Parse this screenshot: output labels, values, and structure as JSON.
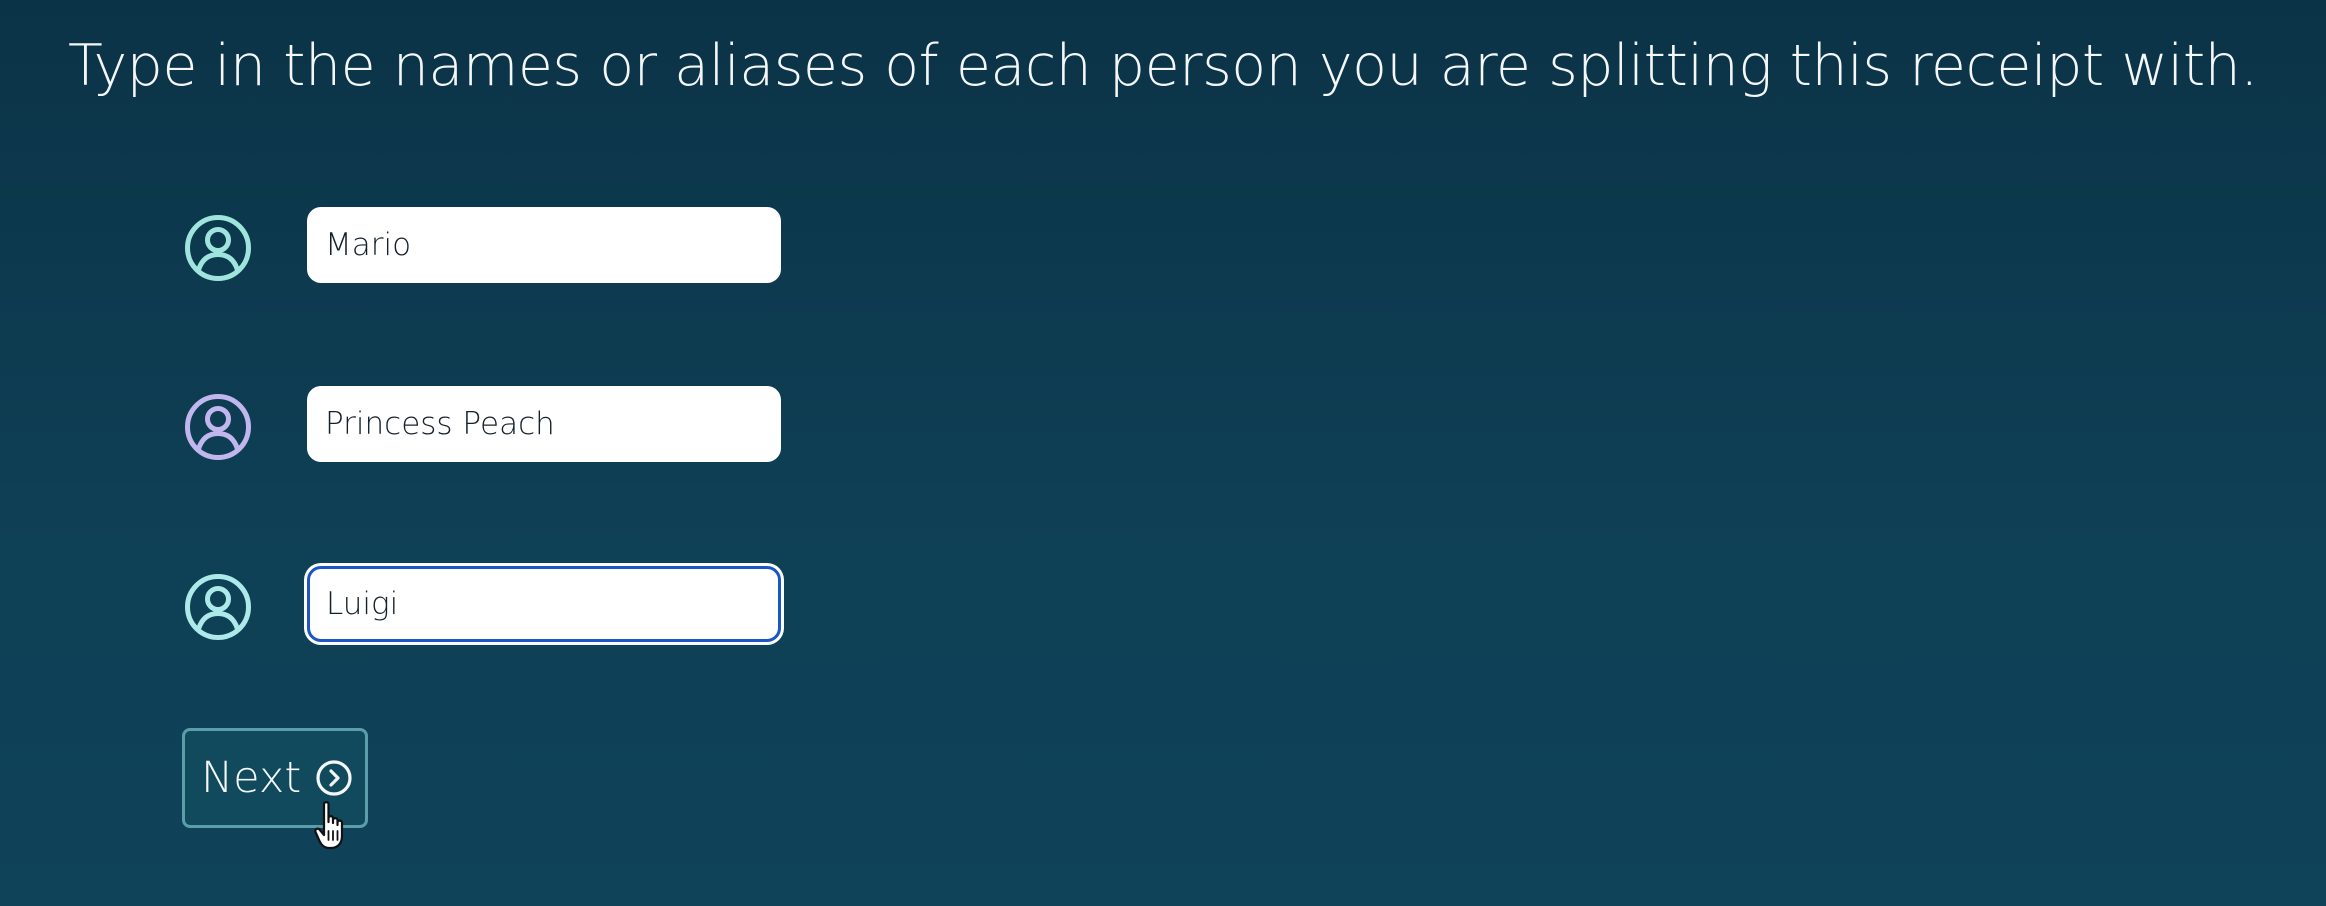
{
  "prompt": {
    "text": "Type in the names or aliases of each person you are splitting this receipt with."
  },
  "people": [
    {
      "value": "Mario",
      "icon": "user-circle-icon",
      "icon_color": "#9fe5de",
      "focused": false
    },
    {
      "value": "Princess Peach",
      "icon": "user-circle-icon",
      "icon_color": "#c2b6ee",
      "focused": false
    },
    {
      "value": "Luigi",
      "icon": "user-circle-icon",
      "icon_color": "#aee9ea",
      "focused": true
    }
  ],
  "next_button": {
    "label": "Next",
    "icon": "chevron-right-circle-icon"
  },
  "colors": {
    "background": "#0d3a4f",
    "text": "#f4f7f8",
    "button_border": "#5b9ea9",
    "focus_ring": "#1a56c4"
  }
}
